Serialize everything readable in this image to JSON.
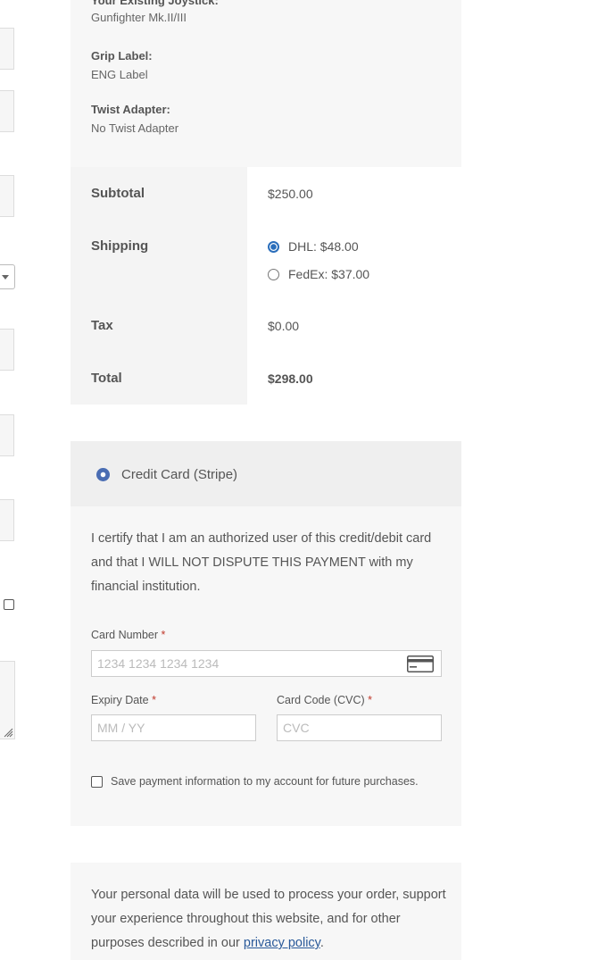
{
  "product_meta": [
    {
      "label": "Your Existing Joystick:",
      "value": "Gunfighter Mk.II/III"
    },
    {
      "label": "Grip Label:",
      "value": "ENG Label"
    },
    {
      "label": "Twist Adapter:",
      "value": "No Twist Adapter"
    }
  ],
  "totals": {
    "subtotal_label": "Subtotal",
    "subtotal_value": "$250.00",
    "shipping_label": "Shipping",
    "shipping_options": [
      {
        "label": "DHL: $48.00",
        "selected": true
      },
      {
        "label": "FedEx: $37.00",
        "selected": false
      }
    ],
    "tax_label": "Tax",
    "tax_value": "$0.00",
    "total_label": "Total",
    "total_value": "$298.00"
  },
  "payment": {
    "method_label": "Credit Card (Stripe)",
    "certify_text": "I certify that I am an authorized user of this credit/debit card and that I WILL NOT DISPUTE THIS PAYMENT with my financial institution.",
    "card_number_label": "Card Number",
    "card_number_placeholder": "1234 1234 1234 1234",
    "expiry_label": "Expiry Date",
    "expiry_placeholder": "MM / YY",
    "cvc_label": "Card Code (CVC)",
    "cvc_placeholder": "CVC",
    "required_mark": "*",
    "save_label": "Save payment information to my account for future purchases."
  },
  "privacy": {
    "text_before": "Your personal data will be used to process your order, support your experience throughout this website, and for other purposes described in our ",
    "link_text": "privacy policy",
    "text_after": "."
  },
  "icons": {
    "card": "credit-card-icon",
    "resize": "resize-grip-icon"
  },
  "colors": {
    "accent": "#2a6ebb",
    "required": "#c0392b",
    "link": "#2a5a9a"
  }
}
